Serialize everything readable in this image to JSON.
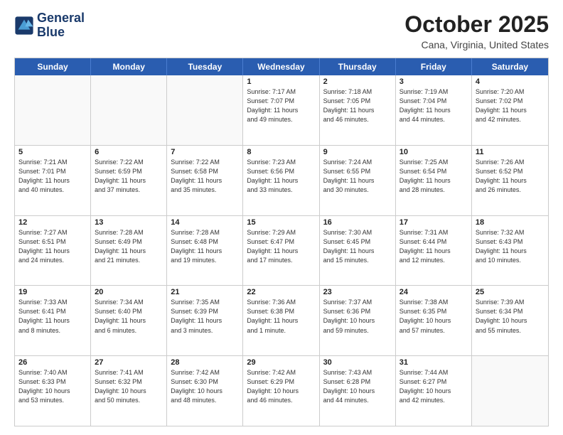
{
  "logo": {
    "line1": "General",
    "line2": "Blue"
  },
  "title": "October 2025",
  "location": "Cana, Virginia, United States",
  "headers": [
    "Sunday",
    "Monday",
    "Tuesday",
    "Wednesday",
    "Thursday",
    "Friday",
    "Saturday"
  ],
  "weeks": [
    [
      {
        "day": "",
        "info": ""
      },
      {
        "day": "",
        "info": ""
      },
      {
        "day": "",
        "info": ""
      },
      {
        "day": "1",
        "info": "Sunrise: 7:17 AM\nSunset: 7:07 PM\nDaylight: 11 hours\nand 49 minutes."
      },
      {
        "day": "2",
        "info": "Sunrise: 7:18 AM\nSunset: 7:05 PM\nDaylight: 11 hours\nand 46 minutes."
      },
      {
        "day": "3",
        "info": "Sunrise: 7:19 AM\nSunset: 7:04 PM\nDaylight: 11 hours\nand 44 minutes."
      },
      {
        "day": "4",
        "info": "Sunrise: 7:20 AM\nSunset: 7:02 PM\nDaylight: 11 hours\nand 42 minutes."
      }
    ],
    [
      {
        "day": "5",
        "info": "Sunrise: 7:21 AM\nSunset: 7:01 PM\nDaylight: 11 hours\nand 40 minutes."
      },
      {
        "day": "6",
        "info": "Sunrise: 7:22 AM\nSunset: 6:59 PM\nDaylight: 11 hours\nand 37 minutes."
      },
      {
        "day": "7",
        "info": "Sunrise: 7:22 AM\nSunset: 6:58 PM\nDaylight: 11 hours\nand 35 minutes."
      },
      {
        "day": "8",
        "info": "Sunrise: 7:23 AM\nSunset: 6:56 PM\nDaylight: 11 hours\nand 33 minutes."
      },
      {
        "day": "9",
        "info": "Sunrise: 7:24 AM\nSunset: 6:55 PM\nDaylight: 11 hours\nand 30 minutes."
      },
      {
        "day": "10",
        "info": "Sunrise: 7:25 AM\nSunset: 6:54 PM\nDaylight: 11 hours\nand 28 minutes."
      },
      {
        "day": "11",
        "info": "Sunrise: 7:26 AM\nSunset: 6:52 PM\nDaylight: 11 hours\nand 26 minutes."
      }
    ],
    [
      {
        "day": "12",
        "info": "Sunrise: 7:27 AM\nSunset: 6:51 PM\nDaylight: 11 hours\nand 24 minutes."
      },
      {
        "day": "13",
        "info": "Sunrise: 7:28 AM\nSunset: 6:49 PM\nDaylight: 11 hours\nand 21 minutes."
      },
      {
        "day": "14",
        "info": "Sunrise: 7:28 AM\nSunset: 6:48 PM\nDaylight: 11 hours\nand 19 minutes."
      },
      {
        "day": "15",
        "info": "Sunrise: 7:29 AM\nSunset: 6:47 PM\nDaylight: 11 hours\nand 17 minutes."
      },
      {
        "day": "16",
        "info": "Sunrise: 7:30 AM\nSunset: 6:45 PM\nDaylight: 11 hours\nand 15 minutes."
      },
      {
        "day": "17",
        "info": "Sunrise: 7:31 AM\nSunset: 6:44 PM\nDaylight: 11 hours\nand 12 minutes."
      },
      {
        "day": "18",
        "info": "Sunrise: 7:32 AM\nSunset: 6:43 PM\nDaylight: 11 hours\nand 10 minutes."
      }
    ],
    [
      {
        "day": "19",
        "info": "Sunrise: 7:33 AM\nSunset: 6:41 PM\nDaylight: 11 hours\nand 8 minutes."
      },
      {
        "day": "20",
        "info": "Sunrise: 7:34 AM\nSunset: 6:40 PM\nDaylight: 11 hours\nand 6 minutes."
      },
      {
        "day": "21",
        "info": "Sunrise: 7:35 AM\nSunset: 6:39 PM\nDaylight: 11 hours\nand 3 minutes."
      },
      {
        "day": "22",
        "info": "Sunrise: 7:36 AM\nSunset: 6:38 PM\nDaylight: 11 hours\nand 1 minute."
      },
      {
        "day": "23",
        "info": "Sunrise: 7:37 AM\nSunset: 6:36 PM\nDaylight: 10 hours\nand 59 minutes."
      },
      {
        "day": "24",
        "info": "Sunrise: 7:38 AM\nSunset: 6:35 PM\nDaylight: 10 hours\nand 57 minutes."
      },
      {
        "day": "25",
        "info": "Sunrise: 7:39 AM\nSunset: 6:34 PM\nDaylight: 10 hours\nand 55 minutes."
      }
    ],
    [
      {
        "day": "26",
        "info": "Sunrise: 7:40 AM\nSunset: 6:33 PM\nDaylight: 10 hours\nand 53 minutes."
      },
      {
        "day": "27",
        "info": "Sunrise: 7:41 AM\nSunset: 6:32 PM\nDaylight: 10 hours\nand 50 minutes."
      },
      {
        "day": "28",
        "info": "Sunrise: 7:42 AM\nSunset: 6:30 PM\nDaylight: 10 hours\nand 48 minutes."
      },
      {
        "day": "29",
        "info": "Sunrise: 7:42 AM\nSunset: 6:29 PM\nDaylight: 10 hours\nand 46 minutes."
      },
      {
        "day": "30",
        "info": "Sunrise: 7:43 AM\nSunset: 6:28 PM\nDaylight: 10 hours\nand 44 minutes."
      },
      {
        "day": "31",
        "info": "Sunrise: 7:44 AM\nSunset: 6:27 PM\nDaylight: 10 hours\nand 42 minutes."
      },
      {
        "day": "",
        "info": ""
      }
    ]
  ]
}
